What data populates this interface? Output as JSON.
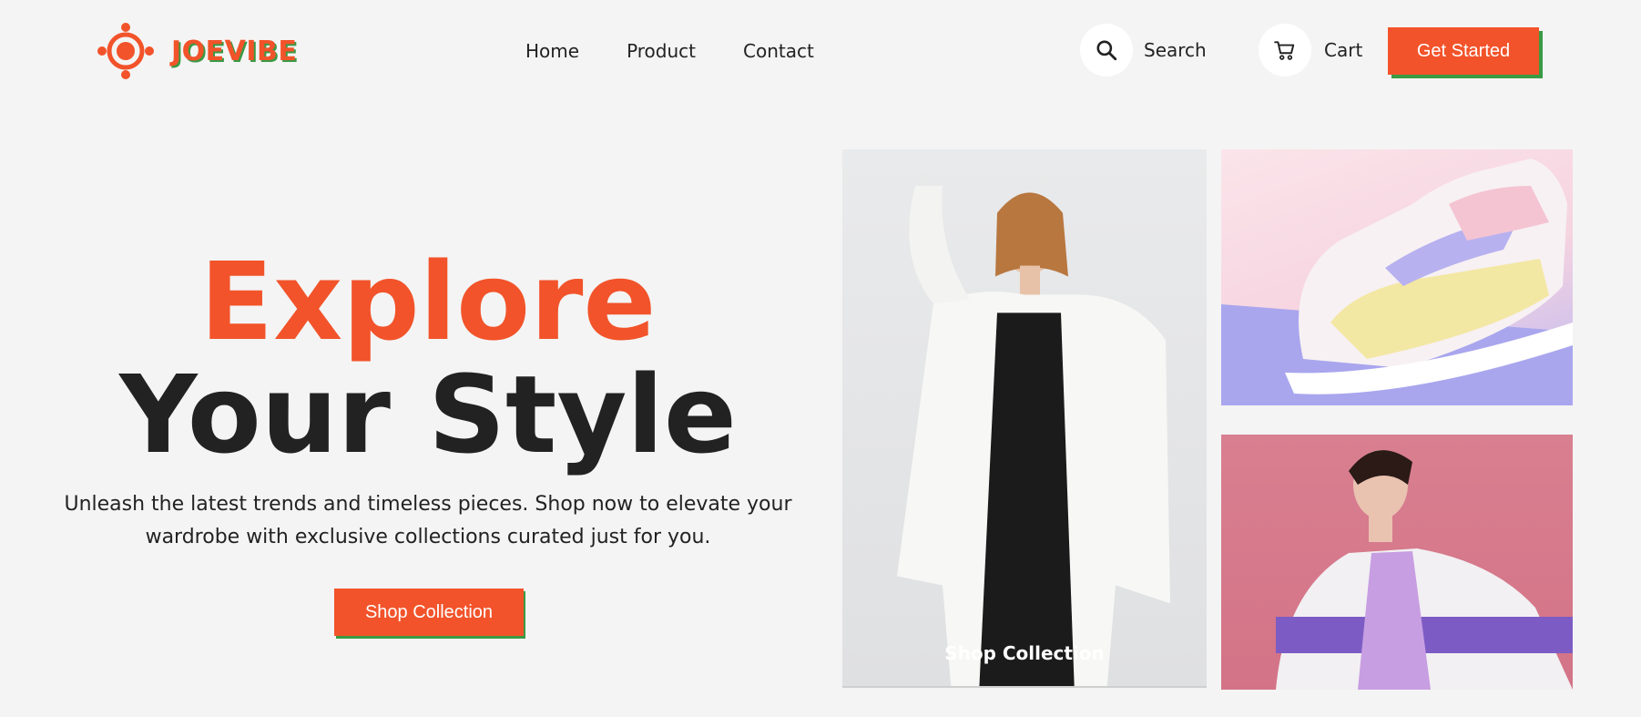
{
  "brand": {
    "name": "JOEVIBE",
    "accent": "#f2532a",
    "shadow": "#3a9a44"
  },
  "nav": {
    "items": [
      "Home",
      "Product",
      "Contact"
    ]
  },
  "header": {
    "search_label": "Search",
    "search_icon": "search-icon",
    "cart_label": "Cart",
    "cart_icon": "cart-icon",
    "cta_label": "Get Started"
  },
  "hero": {
    "title_line1": "Explore",
    "title_line2": "Your Style",
    "subtitle": "Unleash the latest trends and timeless pieces. Shop now to elevate your wardrobe with exclusive collections curated just for you.",
    "button_label": "Shop Collection"
  },
  "gallery": {
    "main_caption": "Shop Collection"
  }
}
